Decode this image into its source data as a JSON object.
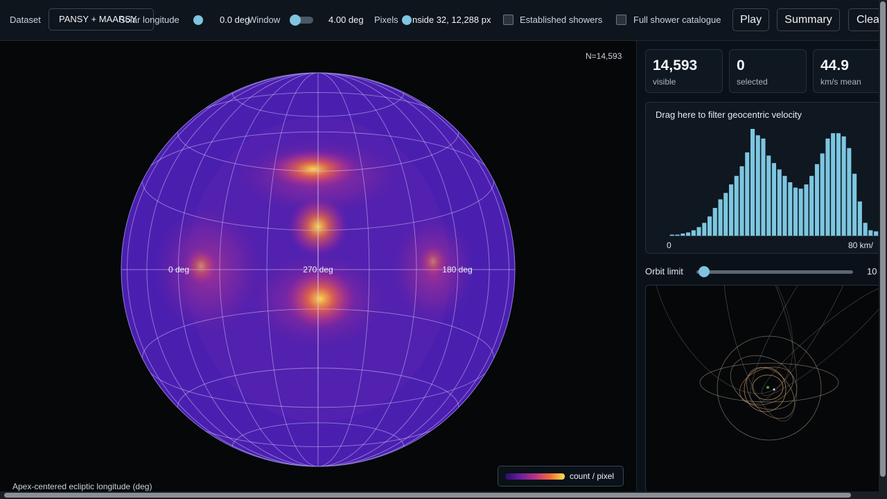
{
  "toolbar": {
    "dataset_label": "Dataset",
    "dataset_value": "PANSY + MAARSY",
    "solar_longitude_label": "Solar longitude",
    "solar_longitude_value": "0.0 deg",
    "window_label": "Window",
    "window_value": "4.00 deg",
    "pixels_label": "Pixels",
    "pixels_value": "nside 32, 12,288 px",
    "established_showers_label": "Established showers",
    "full_catalogue_label": "Full shower catalogue",
    "play_label": "Play",
    "summary_label": "Summary",
    "clear_label": "Clea"
  },
  "map": {
    "count_label": "N=14,593",
    "lon_labels": {
      "left": "0 deg",
      "center": "270 deg",
      "right": "180 deg"
    },
    "xaxis_title": "Apex-centered ecliptic longitude (deg)",
    "legend_label": "count / pixel",
    "colormap": [
      "#2a0d6e",
      "#6a1f9b",
      "#b6338a",
      "#ef6a3c",
      "#fde24a"
    ],
    "globe_fill": "#4a1fb0"
  },
  "stats": [
    {
      "value": "14,593",
      "caption": "visible"
    },
    {
      "value": "0",
      "caption": "selected"
    },
    {
      "value": "44.9",
      "caption": "km/s mean"
    }
  ],
  "histogram": {
    "title": "Drag here to filter geocentric velocity",
    "tick_min": "0",
    "tick_max": "80 km/",
    "bar_color": "#7cc6e0",
    "relative_heights": [
      0.01,
      0.01,
      0.02,
      0.03,
      0.05,
      0.08,
      0.12,
      0.18,
      0.26,
      0.34,
      0.4,
      0.48,
      0.56,
      0.65,
      0.78,
      1.0,
      0.94,
      0.91,
      0.75,
      0.68,
      0.62,
      0.56,
      0.5,
      0.45,
      0.44,
      0.48,
      0.56,
      0.67,
      0.77,
      0.91,
      0.96,
      0.96,
      0.93,
      0.82,
      0.58,
      0.32,
      0.12,
      0.05,
      0.04
    ]
  },
  "orbit_limit": {
    "label": "Orbit limit",
    "value": "10",
    "fraction": 0.05
  }
}
